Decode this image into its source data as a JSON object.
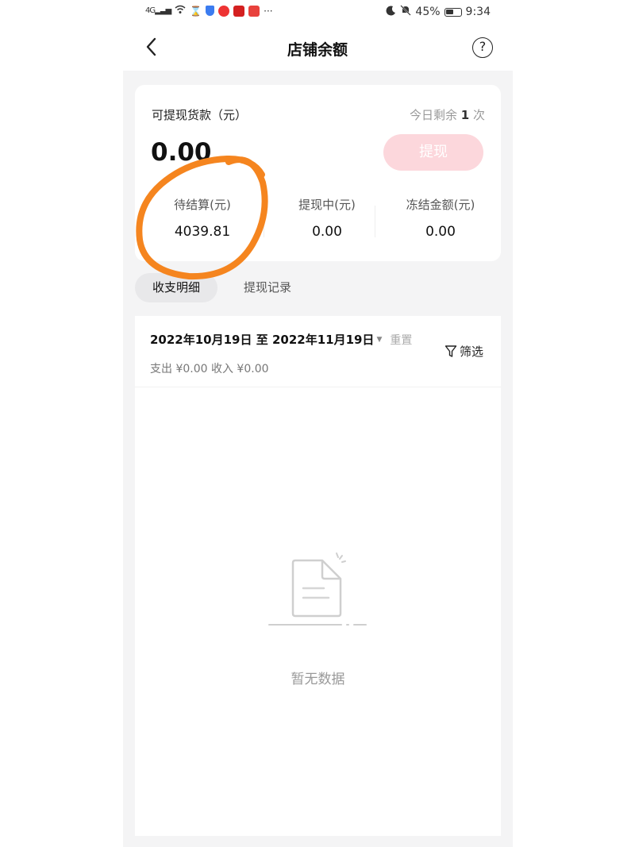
{
  "status_bar": {
    "network": "4G",
    "battery": "45%",
    "time": "9:34",
    "more": "···"
  },
  "header": {
    "title": "店铺余额",
    "help_symbol": "?"
  },
  "balance": {
    "withdrawable_label": "可提现货款（元）",
    "remaining_prefix": "今日剩余",
    "remaining_count": "1",
    "remaining_suffix": "次",
    "withdrawable_amount": "0.00",
    "withdraw_button": "提现",
    "stats": [
      {
        "label": "待结算(元)",
        "value": "4039.81"
      },
      {
        "label": "提现中(元)",
        "value": "0.00"
      },
      {
        "label": "冻结金额(元)",
        "value": "0.00"
      }
    ]
  },
  "tabs": [
    {
      "label": "收支明细"
    },
    {
      "label": "提现记录"
    }
  ],
  "filter": {
    "date_range": "2022年10月19日 至 2022年11月19日",
    "reset_label": "重置",
    "summary": "支出 ¥0.00 收入 ¥0.00",
    "filter_label": "筛选"
  },
  "empty_state": {
    "text": "暂无数据"
  },
  "colors": {
    "accent_disabled": "#fcd7dc",
    "annotation": "#f5851f",
    "panel_bg": "#f4f4f5"
  }
}
